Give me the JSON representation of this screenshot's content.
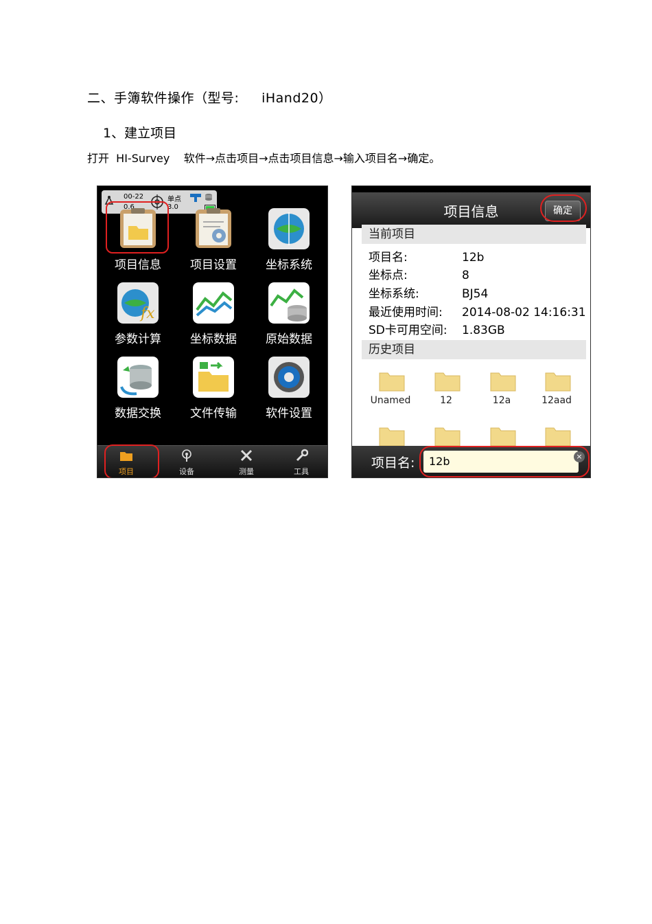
{
  "heading": "二、手簿软件操作（型号:     iHand20）",
  "subheading": "1、建立项目",
  "instruction": "打开  HI-Survey    软件→点击项目→点击项目信息→输入项目名→确定。",
  "left_screen": {
    "status": {
      "l1": "00-22",
      "l2": "0.6",
      "r1": "单点",
      "r2": "3.0"
    },
    "tiles": [
      {
        "label": "项目信息",
        "icon": "project-info-icon"
      },
      {
        "label": "项目设置",
        "icon": "project-settings-icon"
      },
      {
        "label": "坐标系统",
        "icon": "coordinate-system-icon"
      },
      {
        "label": "参数计算",
        "icon": "parameter-calc-icon"
      },
      {
        "label": "坐标数据",
        "icon": "coordinate-data-icon"
      },
      {
        "label": "原始数据",
        "icon": "raw-data-icon"
      },
      {
        "label": "数据交换",
        "icon": "data-exchange-icon"
      },
      {
        "label": "文件传输",
        "icon": "file-transfer-icon"
      },
      {
        "label": "软件设置",
        "icon": "software-settings-icon"
      }
    ],
    "tabs": [
      {
        "label": "项目",
        "icon": "folder-icon"
      },
      {
        "label": "设备",
        "icon": "antenna-icon"
      },
      {
        "label": "测量",
        "icon": "survey-tools-icon"
      },
      {
        "label": "工具",
        "icon": "wrench-icon"
      }
    ],
    "active_tab": "项目"
  },
  "right_screen": {
    "title": "项目信息",
    "ok_label": "确定",
    "current_section": "当前项目",
    "info": [
      {
        "key": "项目名:",
        "value": "12b"
      },
      {
        "key": "坐标点:",
        "value": "8"
      },
      {
        "key": "坐标系统:",
        "value": "BJ54"
      },
      {
        "key": "最近使用时间:",
        "value": "2014-08-02 14:16:31"
      },
      {
        "key": "SD卡可用空间:",
        "value": "1.83GB"
      }
    ],
    "history_section": "历史项目",
    "history": [
      "Unamed",
      "12",
      "12a",
      "12aad"
    ],
    "name_label": "项目名:",
    "name_value": "12b"
  },
  "colors": {
    "highlight": "#e02020",
    "active_tab": "#f0a020",
    "folder": "#f2d98a"
  }
}
